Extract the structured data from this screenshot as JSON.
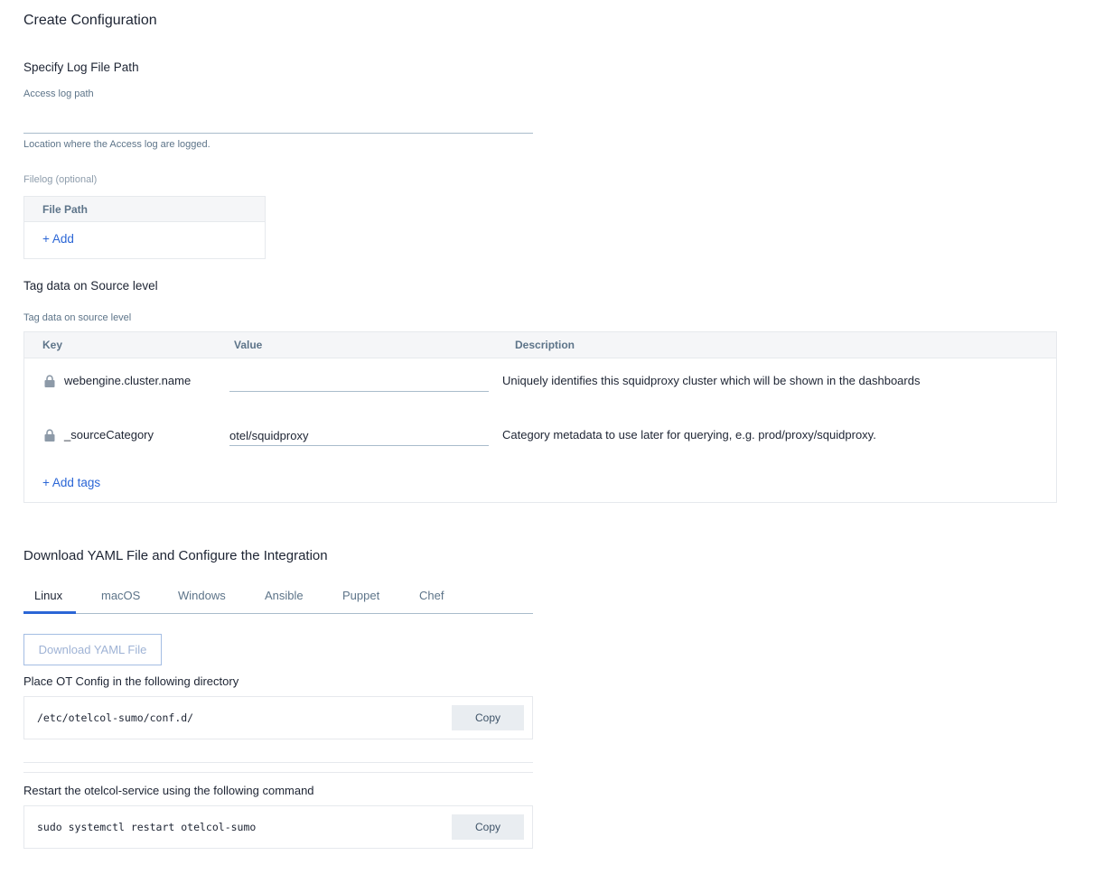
{
  "page": {
    "title": "Create Configuration"
  },
  "log_file_path": {
    "section_title": "Specify Log File Path",
    "access_log": {
      "label": "Access log path",
      "value": "",
      "placeholder": "",
      "helper": "Location where the Access log are logged."
    },
    "filelog": {
      "label": "Filelog (optional)",
      "column_header": "File Path",
      "add_label": "+ Add"
    }
  },
  "tags": {
    "section_title": "Tag data on Source level",
    "table_label": "Tag data on source level",
    "columns": [
      "Key",
      "Value",
      "Description"
    ],
    "rows": [
      {
        "key": "webengine.cluster.name",
        "locked": true,
        "value": "",
        "description": "Uniquely identifies this squidproxy cluster which will be shown in the dashboards"
      },
      {
        "key": "_sourceCategory",
        "locked": true,
        "value": "otel/squidproxy",
        "description": "Category metadata to use later for querying, e.g. prod/proxy/squidproxy."
      }
    ],
    "add_label": "+ Add tags"
  },
  "download": {
    "section_title": "Download YAML File and Configure the Integration",
    "tabs": [
      {
        "label": "Linux",
        "active": true
      },
      {
        "label": "macOS",
        "active": false
      },
      {
        "label": "Windows",
        "active": false
      },
      {
        "label": "Ansible",
        "active": false
      },
      {
        "label": "Puppet",
        "active": false
      },
      {
        "label": "Chef",
        "active": false
      }
    ],
    "download_button": "Download YAML File",
    "step1": {
      "title": "Place OT Config in the following directory",
      "code": "/etc/otelcol-sumo/conf.d/",
      "copy_label": "Copy"
    },
    "step2": {
      "title": "Restart the otelcol-service using the following command",
      "code": "sudo systemctl restart otelcol-sumo",
      "copy_label": "Copy"
    }
  },
  "colors": {
    "accent": "#2b66d6",
    "muted_text": "#5d7489",
    "border": "#e6e9ed",
    "header_bg": "#f5f6f8"
  }
}
